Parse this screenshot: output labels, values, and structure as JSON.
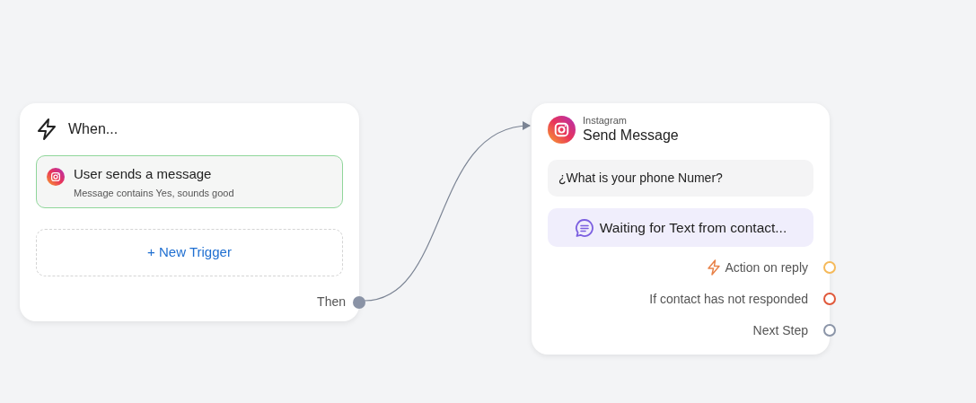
{
  "trigger_node": {
    "title": "When...",
    "triggers": [
      {
        "title": "User sends a message",
        "subtitle": "Message contains Yes, sounds good"
      }
    ],
    "new_trigger": "+ New Trigger",
    "output": "Then"
  },
  "action_node": {
    "channel": "Instagram",
    "title": "Send Message",
    "message": "¿What is your phone Numer?",
    "waiting": "Waiting for Text from contact...",
    "outputs": [
      {
        "label": "Action on reply",
        "kind": "reply",
        "color": "#f5b95a"
      },
      {
        "label": "If contact has not responded",
        "kind": "timeout",
        "color": "#e0583a"
      },
      {
        "label": "Next Step",
        "kind": "next",
        "color": "#8b95a8"
      }
    ]
  }
}
